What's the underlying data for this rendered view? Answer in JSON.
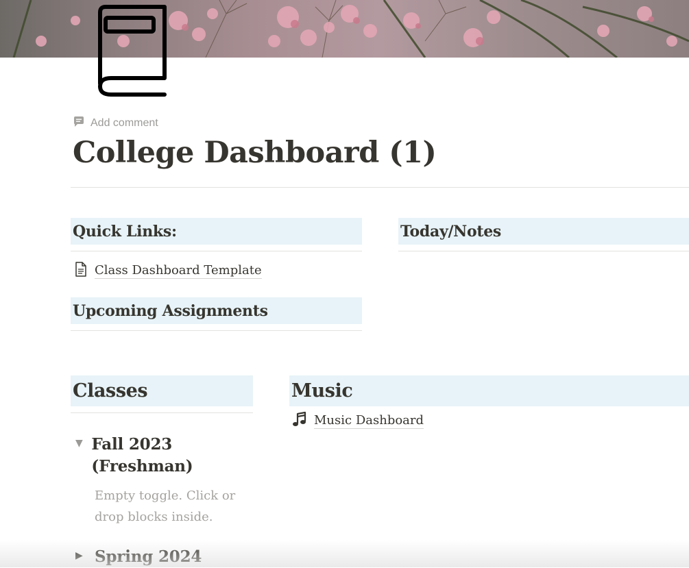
{
  "page": {
    "title": "College Dashboard (1)",
    "add_comment": "Add comment",
    "icon": "book-icon",
    "cover": "pink-flowers-photo"
  },
  "quick_links": {
    "heading": "Quick Links:",
    "items": [
      {
        "label": "Class Dashboard Template",
        "icon": "document-icon"
      }
    ]
  },
  "today_notes": {
    "heading": "Today/Notes"
  },
  "upcoming": {
    "heading": "Upcoming Assignments"
  },
  "classes": {
    "heading": "Classes",
    "toggles": [
      {
        "label": "Fall 2023 (Freshman)",
        "expanded": true,
        "empty_hint": "Empty toggle. Click or drop blocks inside."
      },
      {
        "label": "Spring 2024",
        "expanded": false
      }
    ]
  },
  "music": {
    "heading": "Music",
    "items": [
      {
        "label": "Music Dashboard",
        "icon": "music-note-icon"
      }
    ]
  },
  "colors": {
    "heading_background": "#e7f3f8",
    "text": "#37352f",
    "muted_text": "#9b9a97",
    "divider": "#e3e2e0"
  }
}
